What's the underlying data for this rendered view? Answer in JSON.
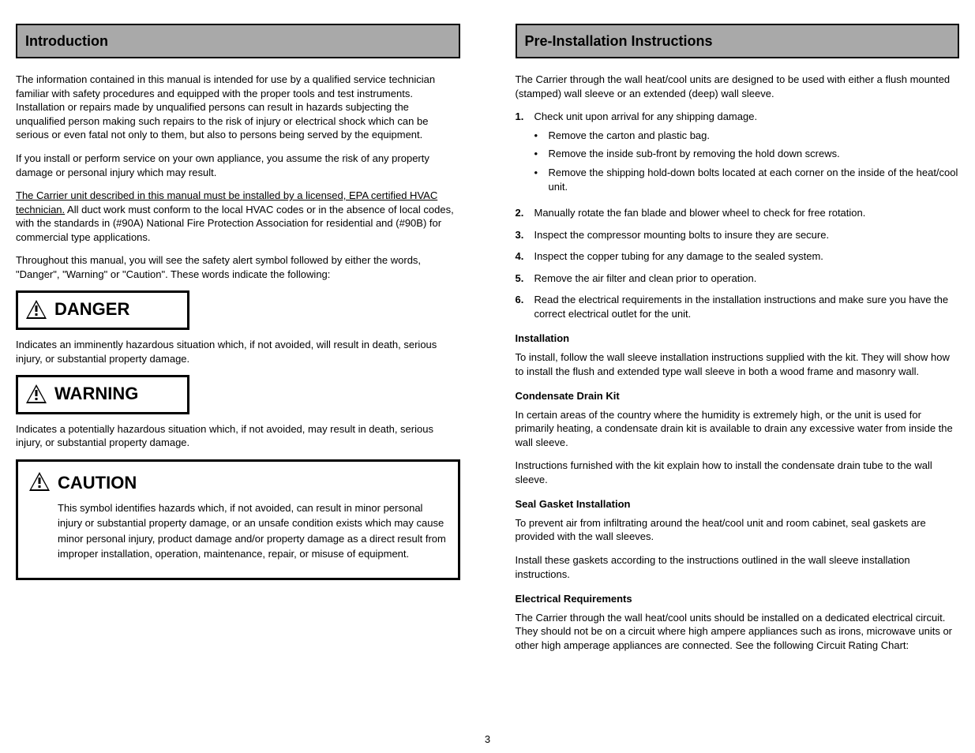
{
  "left": {
    "section_heading": "Introduction",
    "p1a": "The information contained in this manual is intended for use by a qualified service technician familiar with safety procedures and equipped with the proper tools and test instruments. Installation or repairs made by unqualified persons can result in hazards subjecting the unqualified person making such repairs to the risk of injury or electrical shock which can be serious or even fatal not only to them, but also to persons being served by the equipment.",
    "p1b": "If you install or perform service on your own appliance, you assume the risk of any property damage or personal injury which may result.",
    "underline_text": "The Carrier unit described in this manual must be installed by a licensed, EPA certified HVAC technician.",
    "p2b": " All duct work must conform to the local HVAC codes or in the absence of local codes, with the standards in (#90A) National Fire Protection Association for residential and (#90B) for commercial type applications.",
    "p3": "Throughout this manual, you will see the safety alert symbol followed by either the words, \"Danger\", \"Warning\" or \"Caution\". These words indicate the following:",
    "danger_label": "DANGER",
    "danger_text": "Indicates an imminently hazardous situation which, if not avoided, will result in death, serious injury, or substantial property damage.",
    "warning_label_small": "WARNING",
    "warning_text_small": "Indicates a potentially hazardous situation which, if not avoided, may result in death, serious injury, or substantial property damage.",
    "caution_label": "CAUTION",
    "caution_body": "This symbol identifies hazards which, if not avoided, can result in minor personal injury or substantial property damage, or an unsafe condition exists which may cause minor personal injury, product damage and/or property damage as a direct result from improper installation, operation, maintenance, repair, or misuse of equipment."
  },
  "right": {
    "section_heading": "Pre-Installation Instructions",
    "p1": "The Carrier through the wall heat/cool units are designed to be used with either a flush mounted (stamped) wall sleeve or an extended (deep) wall sleeve.",
    "step1_lead": "Check unit upon arrival for any shipping damage.",
    "step1_b1": "Remove the carton and plastic bag.",
    "step1_b2": "Remove the inside sub-front by removing the hold down screws.",
    "step1_b3": "Remove the shipping hold-down bolts located at each corner on the inside of the heat/cool unit.",
    "step2": "Manually rotate the fan blade and blower wheel to check for free rotation.",
    "step3": "Inspect the compressor mounting bolts to insure they are secure.",
    "step4": "Inspect the copper tubing for any damage to the sealed system.",
    "step5": "Remove the air filter and clean prior to operation.",
    "step6": "Read the electrical requirements in the installation instructions and make sure you have the correct electrical outlet for the unit.",
    "sub_install": "Installation",
    "install_p": "To install, follow the wall sleeve installation instructions supplied with the kit. They will show how to install the flush and extended type wall sleeve in both a wood frame and masonry wall.",
    "sub_condensate": "Condensate Drain Kit",
    "cond_p1": "In certain areas of the country where the humidity is extremely high, or the unit is used for primarily heating, a condensate drain kit is available to drain any excessive water from inside the wall sleeve.",
    "cond_p2": "Instructions furnished with the kit explain how to install the condensate drain tube to the wall sleeve.",
    "sub_seal": "Seal Gasket Installation",
    "seal_p1": "To prevent air from infiltrating around the heat/cool unit and room cabinet, seal gaskets are provided with the wall sleeves.",
    "seal_p2": "Install these gaskets according to the instructions outlined in the wall sleeve installation instructions.",
    "sub_elec": "Electrical Requirements",
    "elec_p": "The Carrier through the wall heat/cool units should be installed on a dedicated electrical circuit. They should not be on a circuit where high ampere appliances such as irons, microwave units or other high amperage appliances are connected. See the following Circuit Rating Chart:"
  },
  "page_number": "3"
}
